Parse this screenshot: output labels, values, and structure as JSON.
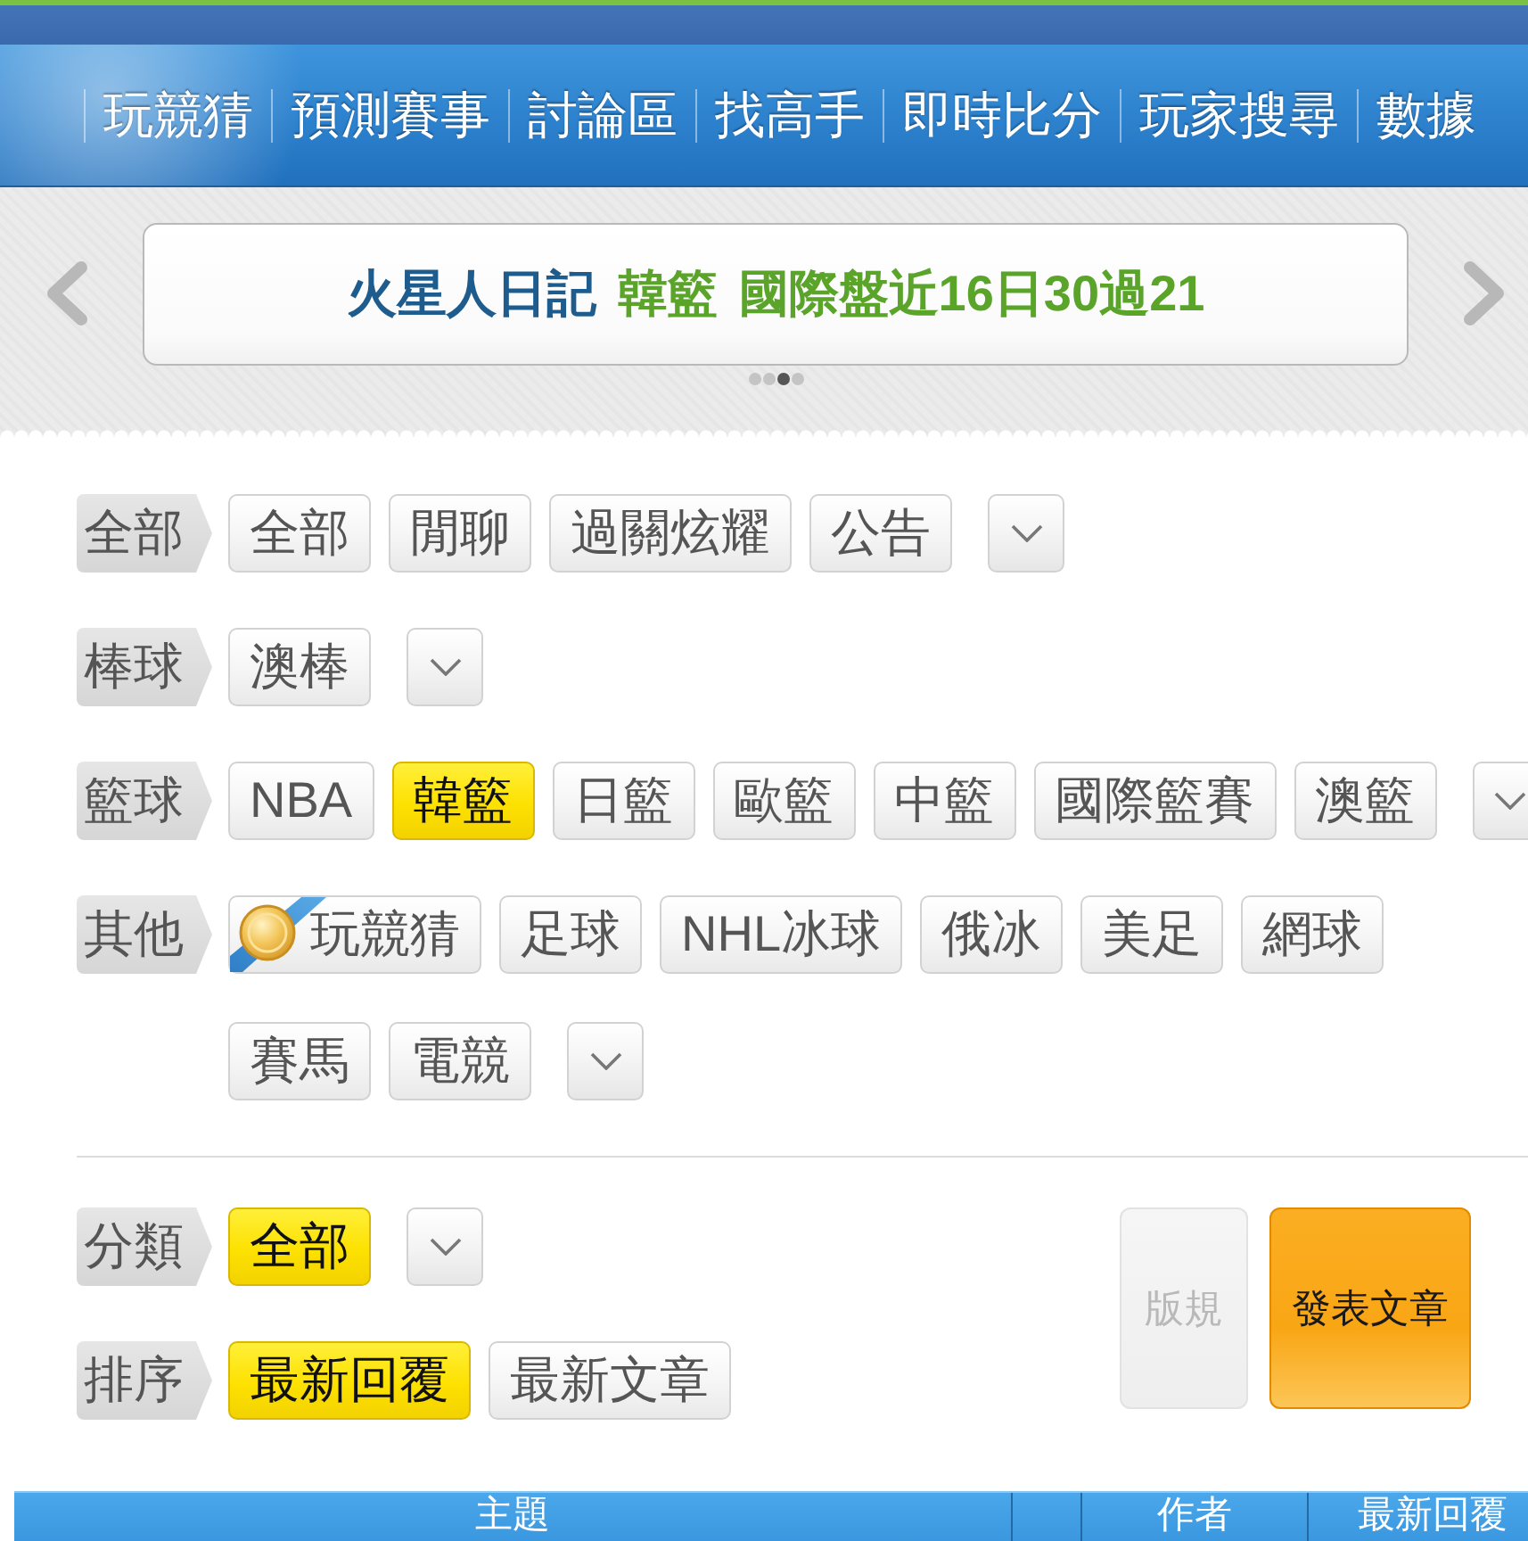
{
  "nav": [
    "玩競猜",
    "預測賽事",
    "討論區",
    "找高手",
    "即時比分",
    "玩家搜尋",
    "數據"
  ],
  "banner": {
    "author": "火星人日記",
    "tag": "韓籃",
    "headline": "國際盤近16日30過21",
    "pager": [
      {
        "selected": false
      },
      {
        "selected": false
      },
      {
        "selected": true
      },
      {
        "selected": false
      }
    ]
  },
  "filters": [
    {
      "label": "全部",
      "chips": [
        {
          "label": "全部",
          "kind": "plain",
          "selected": false
        },
        {
          "label": "閒聊",
          "kind": "plain",
          "selected": false
        },
        {
          "label": "過關炫耀",
          "kind": "plain",
          "selected": false
        },
        {
          "label": "公告",
          "kind": "plain",
          "selected": false
        }
      ],
      "more_button": true
    },
    {
      "label": "棒球",
      "chips": [
        {
          "label": "澳棒",
          "kind": "plain",
          "selected": false
        }
      ],
      "more_button": true
    },
    {
      "label": "籃球",
      "chips": [
        {
          "label": "NBA",
          "kind": "plain",
          "selected": false
        },
        {
          "label": "韓籃",
          "kind": "plain",
          "selected": true
        },
        {
          "label": "日籃",
          "kind": "plain",
          "selected": false
        },
        {
          "label": "歐籃",
          "kind": "plain",
          "selected": false
        },
        {
          "label": "中籃",
          "kind": "plain",
          "selected": false
        },
        {
          "label": "國際籃賽",
          "kind": "plain",
          "selected": false
        },
        {
          "label": "澳籃",
          "kind": "plain",
          "selected": false
        }
      ],
      "more_button": true
    },
    {
      "label": "其他",
      "chips": [
        {
          "label": "玩競猜",
          "kind": "medal",
          "selected": false
        },
        {
          "label": "足球",
          "kind": "plain",
          "selected": false
        },
        {
          "label": "NHL冰球",
          "kind": "plain",
          "selected": false
        },
        {
          "label": "俄冰",
          "kind": "plain",
          "selected": false
        },
        {
          "label": "美足",
          "kind": "plain",
          "selected": false
        },
        {
          "label": "網球",
          "kind": "plain",
          "selected": false
        },
        {
          "label": "賽馬",
          "kind": "plain",
          "selected": false
        },
        {
          "label": "電競",
          "kind": "plain",
          "selected": false
        }
      ],
      "more_button": true
    }
  ],
  "sorting": [
    {
      "label": "分類",
      "chips": [
        {
          "label": "全部",
          "kind": "plain",
          "selected": true
        }
      ],
      "more_button": true
    },
    {
      "label": "排序",
      "chips": [
        {
          "label": "最新回覆",
          "kind": "plain",
          "selected": true
        },
        {
          "label": "最新文章",
          "kind": "plain",
          "selected": false
        }
      ],
      "more_button": false
    }
  ],
  "actions": [
    {
      "label": "版規",
      "disabled": true
    },
    {
      "label": "發表文章",
      "disabled": false
    }
  ],
  "table": {
    "columns": [
      {
        "kind": "text",
        "label": "主題"
      },
      {
        "kind": "blank"
      },
      {
        "kind": "text",
        "label": "作者"
      },
      {
        "kind": "text",
        "label": "最新回覆"
      }
    ]
  }
}
